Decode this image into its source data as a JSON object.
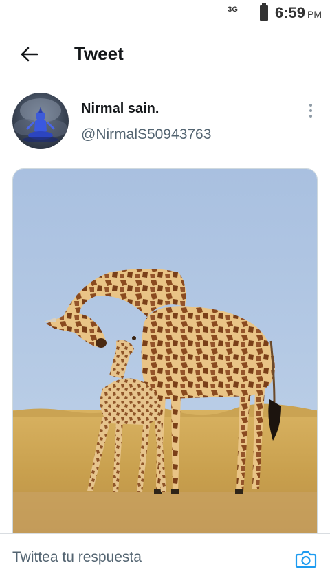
{
  "status_bar": {
    "network": "3G",
    "time": "6:59",
    "ampm": "PM",
    "battery_icon": "battery-icon"
  },
  "header": {
    "title": "Tweet",
    "back_icon": "arrow-left-icon"
  },
  "tweet": {
    "author": {
      "name": "Nirmal sain.",
      "handle": "@NirmalS50943763"
    },
    "more_icon": "more-vertical-icon"
  },
  "reply": {
    "placeholder": "Twittea tu respuesta",
    "camera_icon": "camera-icon"
  },
  "colors": {
    "accent": "#1d9bf0",
    "secondary_text": "#536471",
    "divider": "#d9dde1"
  }
}
